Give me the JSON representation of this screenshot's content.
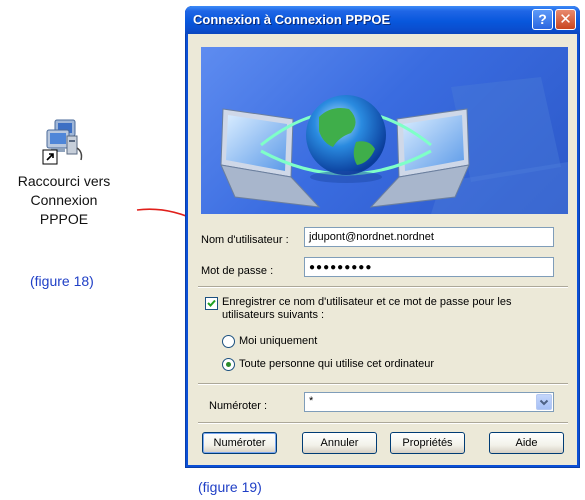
{
  "shortcut": {
    "label_lines": [
      "Raccourci vers",
      "Connexion",
      "PPPOE"
    ],
    "figure_caption": "(figure 18)"
  },
  "dialog": {
    "title": "Connexion à Connexion PPPOE",
    "help_label": "?",
    "close_label": "✕",
    "username_label": "Nom d'utilisateur :",
    "username_value": "jdupont@nordnet.nordnet",
    "password_label": "Mot de passe :",
    "password_value": "●●●●●●●●●",
    "save_credentials_label": "Enregistrer ce nom d'utilisateur et ce mot de passe pour les utilisateurs suivants :",
    "save_credentials_checked": true,
    "radio_me_only_label": "Moi uniquement",
    "radio_anyone_label": "Toute personne qui utilise cet ordinateur",
    "selected_radio": "anyone",
    "dial_label": "Numéroter :",
    "dial_value": "*",
    "buttons": {
      "dial": "Numéroter",
      "cancel": "Annuler",
      "properties": "Propriétés",
      "help": "Aide"
    }
  },
  "figure19_caption": "(figure 19)",
  "colors": {
    "titlebar": "#0a4dce",
    "caption_blue": "#1f3fc6",
    "arrow_red": "#e0201b",
    "dialog_face": "#ece9d8"
  }
}
